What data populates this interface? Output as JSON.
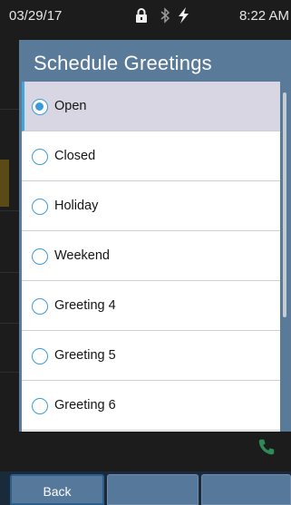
{
  "status_bar": {
    "date": "03/29/17",
    "time": "8:22 AM",
    "icons": [
      "lock-icon",
      "bluetooth-icon",
      "charging-bolt-icon"
    ]
  },
  "dialog": {
    "title": "Schedule Greetings",
    "selected_index": 0,
    "options": [
      {
        "label": "Open"
      },
      {
        "label": "Closed"
      },
      {
        "label": "Holiday"
      },
      {
        "label": "Weekend"
      },
      {
        "label": "Greeting 4"
      },
      {
        "label": "Greeting 5"
      },
      {
        "label": "Greeting 6"
      }
    ]
  },
  "softkeys": {
    "back_label": "Back",
    "key2_label": "",
    "key3_label": ""
  },
  "colors": {
    "dialog_header": "#5a7a99",
    "accent": "#3a9bd8",
    "selected_row": "#d8d6e2",
    "call_icon": "#2e8b57"
  }
}
